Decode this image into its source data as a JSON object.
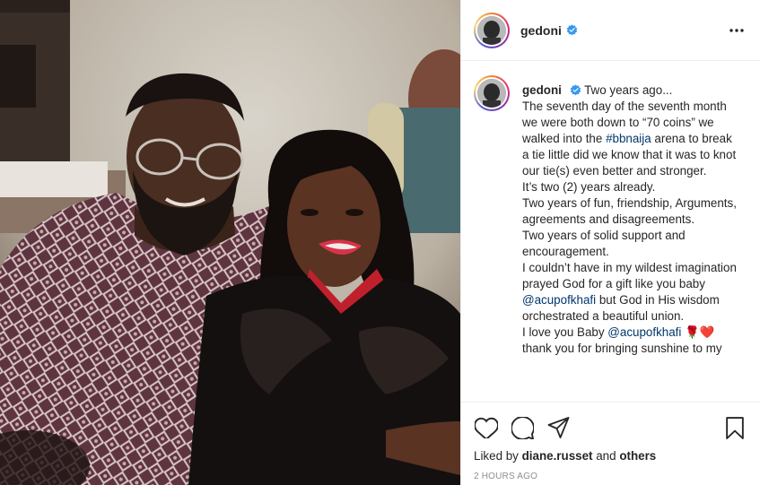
{
  "post": {
    "username": "gedoni",
    "verified": true,
    "caption": {
      "intro_time": "Two years ago...",
      "lines": [
        {
          "segments": [
            {
              "text": "The seventh day of the seventh month we were both down to “70 coins” we walked into the "
            },
            {
              "text": "#bbnaija",
              "link": true
            },
            {
              "text": " arena to break a tie little did we know that it was to knot our tie(s) even better and stronger."
            }
          ]
        },
        {
          "segments": [
            {
              "text": "It’s two (2) years already."
            }
          ]
        },
        {
          "segments": [
            {
              "text": "Two years of fun, friendship, Arguments, agreements and disagreements."
            }
          ]
        },
        {
          "segments": [
            {
              "text": "Two years of solid support and encouragement."
            }
          ]
        },
        {
          "segments": [
            {
              "text": "I couldn’t have in my wildest imagination prayed God for a gift like you baby "
            },
            {
              "text": "@acupofkhafi",
              "link": true
            },
            {
              "text": " but God in His wisdom orchestrated a beautiful union."
            }
          ]
        },
        {
          "segments": [
            {
              "text": "I love you Baby "
            },
            {
              "text": "@acupofkhafi",
              "link": true
            },
            {
              "text": " 🌹❤️"
            }
          ]
        },
        {
          "segments": [
            {
              "text": "thank you for bringing sunshine to my"
            }
          ]
        }
      ]
    },
    "likes": {
      "prefix": "Liked by",
      "user": "diane.russet",
      "and": "and",
      "others": "others"
    },
    "timestamp": "2 HOURS AGO"
  },
  "icons": {
    "more": "more-options-icon",
    "like": "heart-icon",
    "comment": "comment-icon",
    "share": "share-icon",
    "save": "bookmark-icon",
    "verified": "verified-badge-icon"
  },
  "colors": {
    "link": "#00376b",
    "verified": "#3897f0",
    "text": "#262626",
    "muted": "#8e8e8e"
  }
}
